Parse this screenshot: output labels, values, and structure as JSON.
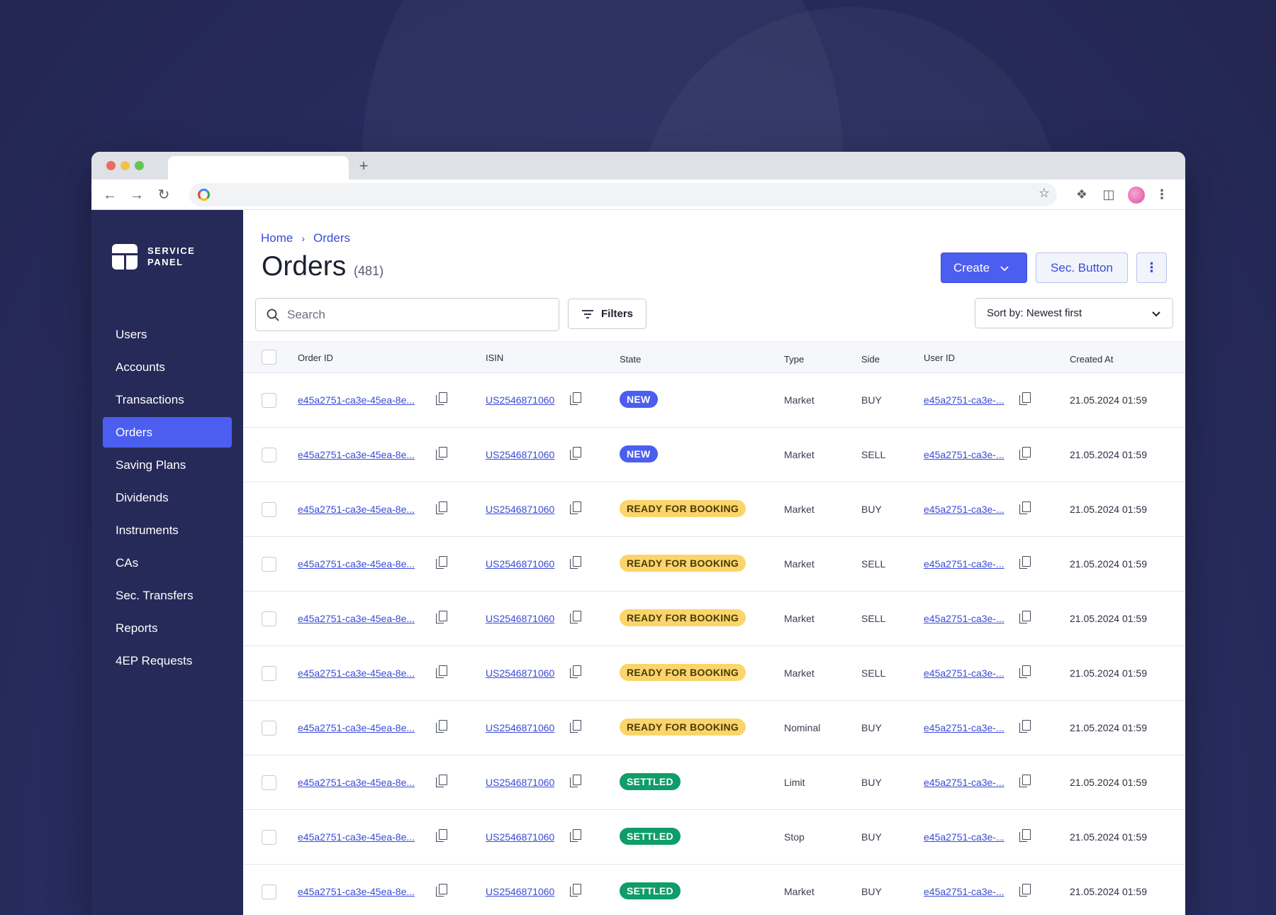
{
  "app": {
    "brand_line1": "SERVICE",
    "brand_line2": "PANEL"
  },
  "sidebar": {
    "items": [
      {
        "label": "Users",
        "active": false
      },
      {
        "label": "Accounts",
        "active": false
      },
      {
        "label": "Transactions",
        "active": false
      },
      {
        "label": "Orders",
        "active": true
      },
      {
        "label": "Saving Plans",
        "active": false
      },
      {
        "label": "Dividends",
        "active": false
      },
      {
        "label": "Instruments",
        "active": false
      },
      {
        "label": "CAs",
        "active": false
      },
      {
        "label": "Sec. Transfers",
        "active": false
      },
      {
        "label": "Reports",
        "active": false
      },
      {
        "label": "4EP Requests",
        "active": false
      }
    ]
  },
  "breadcrumb": {
    "home": "Home",
    "separator": "›",
    "current": "Orders"
  },
  "page": {
    "title": "Orders",
    "count": "(481)"
  },
  "toolbar": {
    "create_label": "Create",
    "sec_label": "Sec. Button",
    "search_placeholder": "Search",
    "filters_label": "Filters",
    "sort_label": "Sort by: Newest first"
  },
  "table": {
    "columns": [
      "Order ID",
      "ISIN",
      "State",
      "Type",
      "Side",
      "User ID",
      "Created At"
    ],
    "rows": [
      {
        "order_id": "e45a2751-ca3e-45ea-8e...",
        "isin": "US2546871060",
        "state": "NEW",
        "state_kind": "new",
        "type": "Market",
        "side": "BUY",
        "user_id": "e45a2751-ca3e-...",
        "created_at": "21.05.2024 01:59"
      },
      {
        "order_id": "e45a2751-ca3e-45ea-8e...",
        "isin": "US2546871060",
        "state": "NEW",
        "state_kind": "new",
        "type": "Market",
        "side": "SELL",
        "user_id": "e45a2751-ca3e-...",
        "created_at": "21.05.2024 01:59"
      },
      {
        "order_id": "e45a2751-ca3e-45ea-8e...",
        "isin": "US2546871060",
        "state": "READY FOR BOOKING",
        "state_kind": "ready",
        "type": "Market",
        "side": "BUY",
        "user_id": "e45a2751-ca3e-...",
        "created_at": "21.05.2024 01:59"
      },
      {
        "order_id": "e45a2751-ca3e-45ea-8e...",
        "isin": "US2546871060",
        "state": "READY FOR BOOKING",
        "state_kind": "ready",
        "type": "Market",
        "side": "SELL",
        "user_id": "e45a2751-ca3e-...",
        "created_at": "21.05.2024 01:59"
      },
      {
        "order_id": "e45a2751-ca3e-45ea-8e...",
        "isin": "US2546871060",
        "state": "READY FOR BOOKING",
        "state_kind": "ready",
        "type": "Market",
        "side": "SELL",
        "user_id": "e45a2751-ca3e-...",
        "created_at": "21.05.2024 01:59"
      },
      {
        "order_id": "e45a2751-ca3e-45ea-8e...",
        "isin": "US2546871060",
        "state": "READY FOR BOOKING",
        "state_kind": "ready",
        "type": "Market",
        "side": "SELL",
        "user_id": "e45a2751-ca3e-...",
        "created_at": "21.05.2024 01:59"
      },
      {
        "order_id": "e45a2751-ca3e-45ea-8e...",
        "isin": "US2546871060",
        "state": "READY FOR BOOKING",
        "state_kind": "ready",
        "type": "Nominal",
        "side": "BUY",
        "user_id": "e45a2751-ca3e-...",
        "created_at": "21.05.2024 01:59"
      },
      {
        "order_id": "e45a2751-ca3e-45ea-8e...",
        "isin": "US2546871060",
        "state": "SETTLED",
        "state_kind": "settled",
        "type": "Limit",
        "side": "BUY",
        "user_id": "e45a2751-ca3e-...",
        "created_at": "21.05.2024 01:59"
      },
      {
        "order_id": "e45a2751-ca3e-45ea-8e...",
        "isin": "US2546871060",
        "state": "SETTLED",
        "state_kind": "settled",
        "type": "Stop",
        "side": "BUY",
        "user_id": "e45a2751-ca3e-...",
        "created_at": "21.05.2024 01:59"
      },
      {
        "order_id": "e45a2751-ca3e-45ea-8e...",
        "isin": "US2546871060",
        "state": "SETTLED",
        "state_kind": "settled",
        "type": "Market",
        "side": "BUY",
        "user_id": "e45a2751-ca3e-...",
        "created_at": "21.05.2024 01:59"
      }
    ]
  },
  "colors": {
    "accent": "#4b5ef0",
    "sidebar_bg": "#262a58",
    "badge_new": "#4b5ef0",
    "badge_ready": "#fbd56b",
    "badge_settled": "#0f9d6a"
  },
  "icons": {
    "search": "search-icon",
    "filters": "filter-icon",
    "copy": "copy-icon",
    "chevron": "chevron-down-icon",
    "kebab": "kebab-menu-icon"
  }
}
